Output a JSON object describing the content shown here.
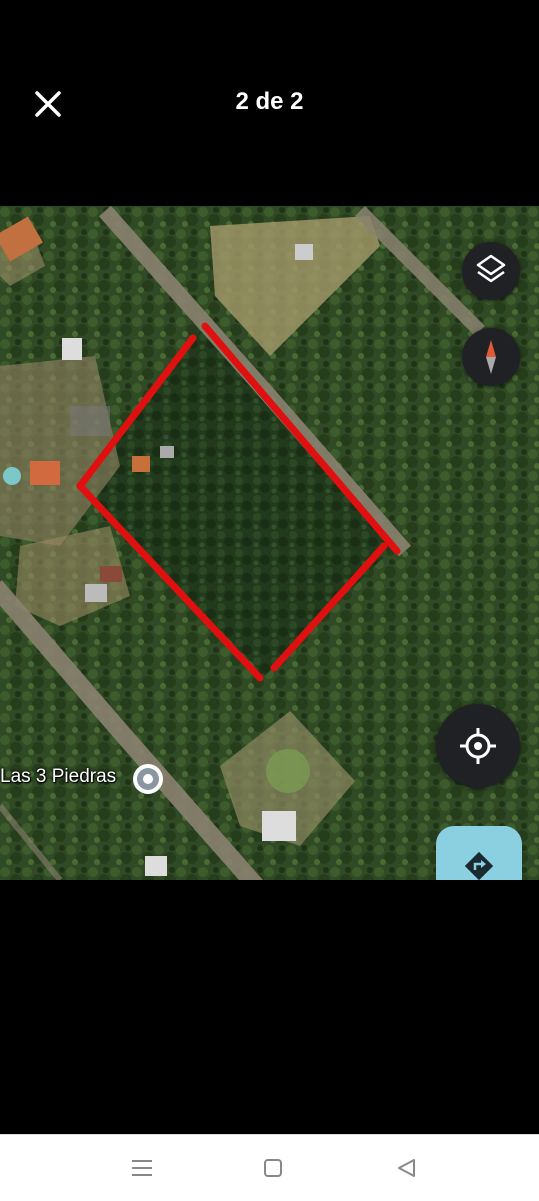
{
  "header": {
    "counter_text": "2 de 2",
    "close_icon": "close-icon"
  },
  "map": {
    "poi_label": "Las 3 Piedras",
    "boundary_color": "#e01010",
    "controls": [
      "layers-icon",
      "compass-icon",
      "my-location-icon",
      "directions-icon"
    ]
  },
  "nav_bar": {
    "buttons": [
      "menu-icon",
      "home-icon",
      "back-icon"
    ]
  }
}
